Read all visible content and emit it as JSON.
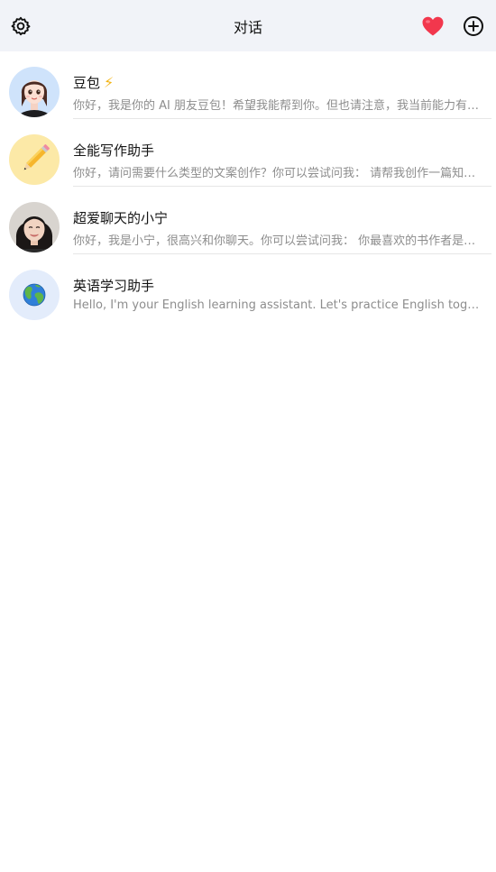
{
  "header": {
    "title": "对话",
    "icons": [
      "gear-icon",
      "heart-icon",
      "plus-circle-icon"
    ]
  },
  "conversations": [
    {
      "name": "豆包",
      "badge": "⚡",
      "preview": "你好，我是你的 AI 朋友豆包！希望我能帮到你。但也请注意，我当前能力有限，可能会出错。",
      "avatar": "girl-avatar"
    },
    {
      "name": "全能写作助手",
      "preview": "你好，请问需要什么类型的文案创作？你可以尝试问我： 请帮我创作一篇知乎风格的文章",
      "avatar": "pencil-icon",
      "avatar_bg": "#fce9a7"
    },
    {
      "name": "超爱聊天的小宁",
      "preview": "你好，我是小宁，很高兴和你聊天。你可以尝试问我： 你最喜欢的书作者是谁？",
      "avatar": "woman-photo-avatar"
    },
    {
      "name": "英语学习助手",
      "preview": "Hello, I'm your English learning assistant. Let's practice English together! You can ask me anything.",
      "avatar": "globe-icon",
      "avatar_bg": "#e3ecfb"
    }
  ],
  "colors": {
    "header_bg": "#f1f3f8",
    "heart": "#f2374d",
    "badge": "#f3b415"
  }
}
